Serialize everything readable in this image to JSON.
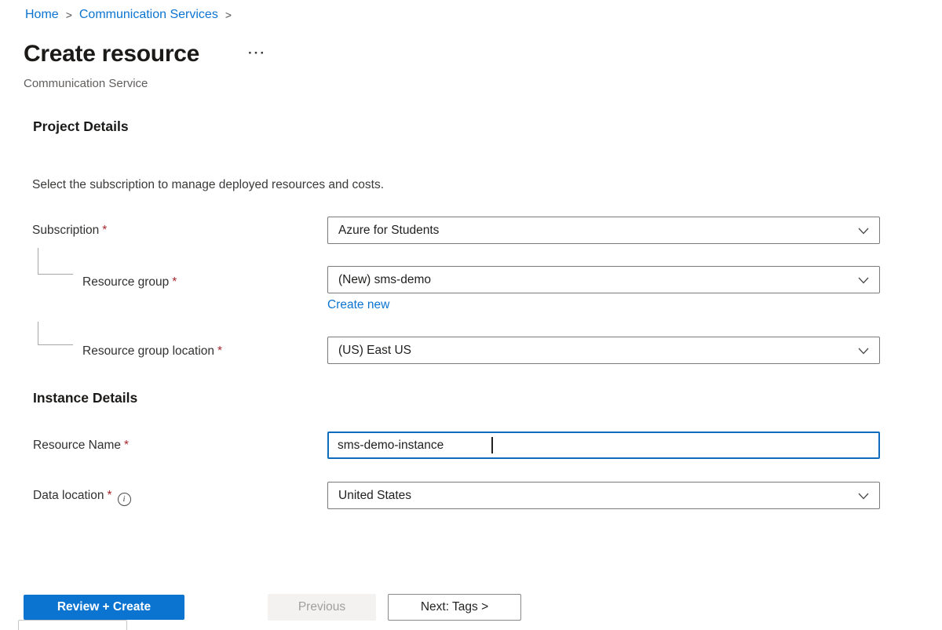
{
  "breadcrumb": {
    "separator": ">",
    "items": [
      {
        "label": "Home"
      },
      {
        "label": "Communication Services"
      }
    ]
  },
  "header": {
    "title": "Create resource",
    "subtitle": "Communication Service"
  },
  "icons": {
    "more": "···",
    "info": "i",
    "chevron_down": "⌄"
  },
  "project_details": {
    "heading": "Project Details",
    "description": "Select the subscription to manage deployed resources and costs.",
    "subscription": {
      "label": "Subscription",
      "required": "*",
      "value": "Azure for Students"
    },
    "resource_group": {
      "label": "Resource group",
      "required": "*",
      "value": "(New) sms-demo",
      "create_new_label": "Create new"
    },
    "resource_group_location": {
      "label": "Resource group location",
      "required": "*",
      "value": "(US) East US"
    }
  },
  "instance_details": {
    "heading": "Instance Details",
    "resource_name": {
      "label": "Resource Name",
      "required": "*",
      "value": "sms-demo-instance"
    },
    "data_location": {
      "label": "Data location",
      "required": "*",
      "value": "United States"
    }
  },
  "footer": {
    "review_create_label": "Review + Create",
    "previous_label": "Previous",
    "next_label": "Next: Tags >"
  },
  "colors": {
    "accent": "#0b74d1",
    "required": "#a4262c",
    "text": "#323130",
    "muted": "#605e5c",
    "field_border": "#7a7a78",
    "focus_border": "#0f6cbd",
    "disabled_bg": "#f3f2f1",
    "disabled_text": "#a19f9d"
  }
}
